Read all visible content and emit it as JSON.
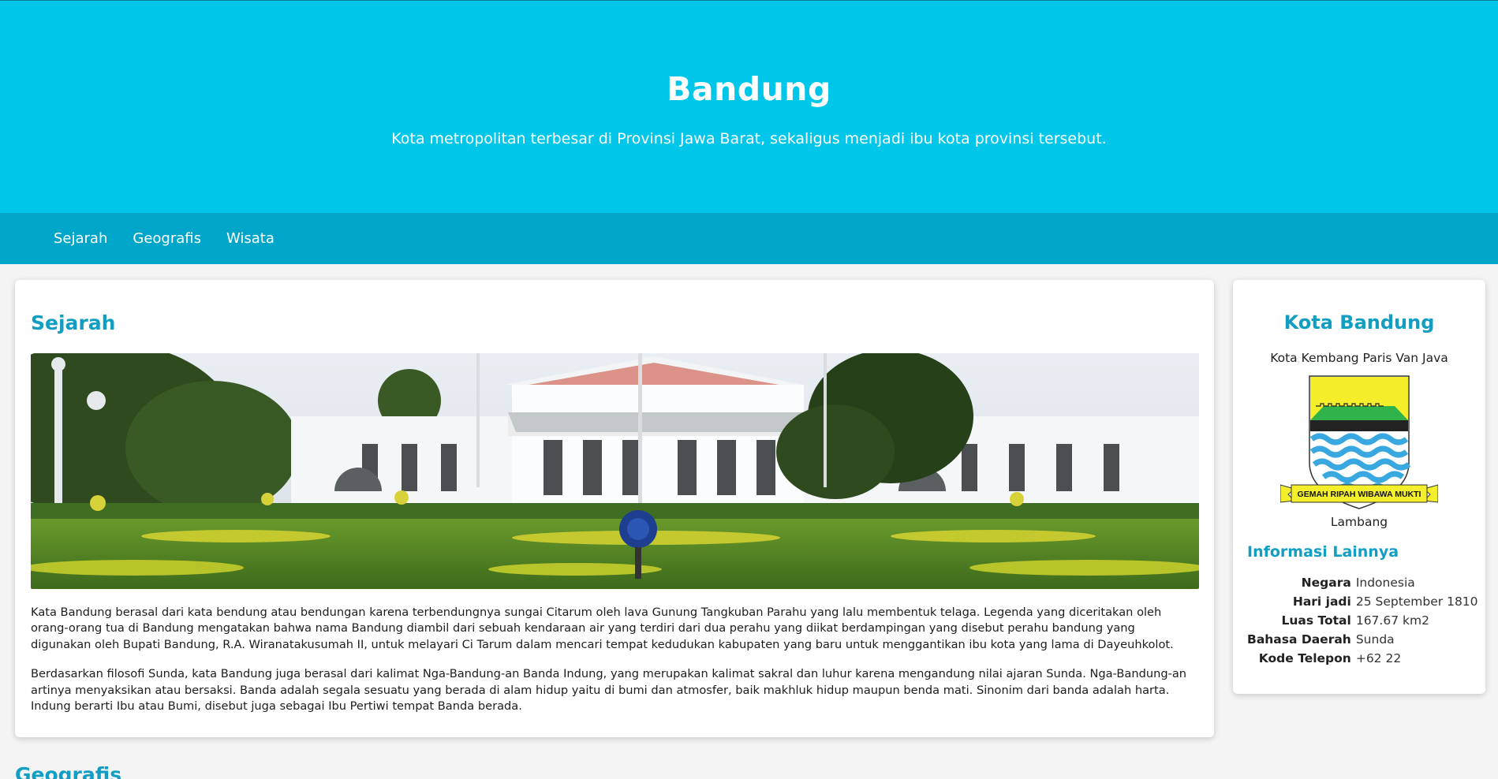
{
  "hero": {
    "title": "Bandung",
    "subtitle": "Kota metropolitan terbesar di Provinsi Jawa Barat, sekaligus menjadi ibu kota provinsi tersebut."
  },
  "nav": {
    "items": [
      {
        "label": "Sejarah"
      },
      {
        "label": "Geografis"
      },
      {
        "label": "Wisata"
      }
    ]
  },
  "sejarah": {
    "title": "Sejarah",
    "paragraphs": [
      "Kata Bandung berasal dari kata bendung atau bendungan karena terbendungnya sungai Citarum oleh lava Gunung Tangkuban Parahu yang lalu membentuk telaga. Legenda yang diceritakan oleh orang-orang tua di Bandung mengatakan bahwa nama Bandung diambil dari sebuah kendaraan air yang terdiri dari dua perahu yang diikat berdampingan yang disebut perahu bandung yang digunakan oleh Bupati Bandung, R.A. Wiranatakusumah II, untuk melayari Ci Tarum dalam mencari tempat kedudukan kabupaten yang baru untuk menggantikan ibu kota yang lama di Dayeuhkolot.",
      "Berdasarkan filosofi Sunda, kata Bandung juga berasal dari kalimat Nga-Bandung-an Banda Indung, yang merupakan kalimat sakral dan luhur karena mengandung nilai ajaran Sunda. Nga-Bandung-an artinya menyaksikan atau bersaksi. Banda adalah segala sesuatu yang berada di alam hidup yaitu di bumi dan atmosfer, baik makhluk hidup maupun benda mati. Sinonim dari banda adalah harta. Indung berarti Ibu atau Bumi, disebut juga sebagai Ibu Pertiwi tempat Banda berada."
    ]
  },
  "sidebar": {
    "title": "Kota Bandung",
    "motto": "Kota Kembang Paris Van Java",
    "emblem_ribbon": "GEMAH RIPAH WIBAWA MUKTI",
    "emblem_caption": "Lambang",
    "info_title": "Informasi Lainnya",
    "info": [
      {
        "key": "Negara",
        "value": "Indonesia"
      },
      {
        "key": "Hari jadi",
        "value": "25 September 1810"
      },
      {
        "key": "Luas Total",
        "value": "167.67 km2"
      },
      {
        "key": "Bahasa Daerah",
        "value": "Sunda"
      },
      {
        "key": "Kode Telepon",
        "value": "+62 22"
      }
    ]
  },
  "next_section": {
    "title": "Geografis"
  },
  "colors": {
    "hero_bg": "#00c6ea",
    "nav_bg": "#00a6c9",
    "accent": "#129ec3"
  }
}
